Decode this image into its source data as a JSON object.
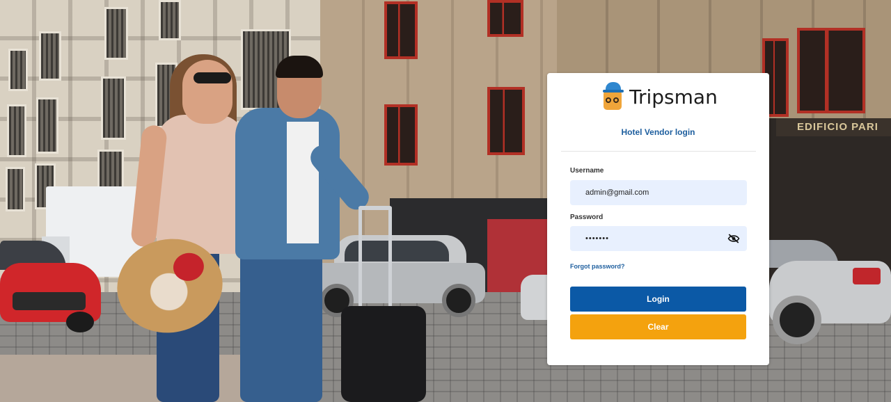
{
  "brand": {
    "name": "Tripsman"
  },
  "login": {
    "subtitle": "Hotel Vendor login",
    "username_label": "Username",
    "username_value": "admin@gmail.com",
    "password_label": "Password",
    "password_value": "•••••••",
    "forgot_label": "Forgot password?",
    "login_button": "Login",
    "clear_button": "Clear"
  },
  "background": {
    "sign_text": "EDIFICIO PARI"
  },
  "colors": {
    "primary": "#0b59a6",
    "secondary": "#f4a20e",
    "input_bg": "#e8f0fe",
    "link": "#1d5e9e"
  },
  "icons": {
    "password_toggle": "eye-off-icon",
    "logo": "tripsman-logo-icon"
  }
}
